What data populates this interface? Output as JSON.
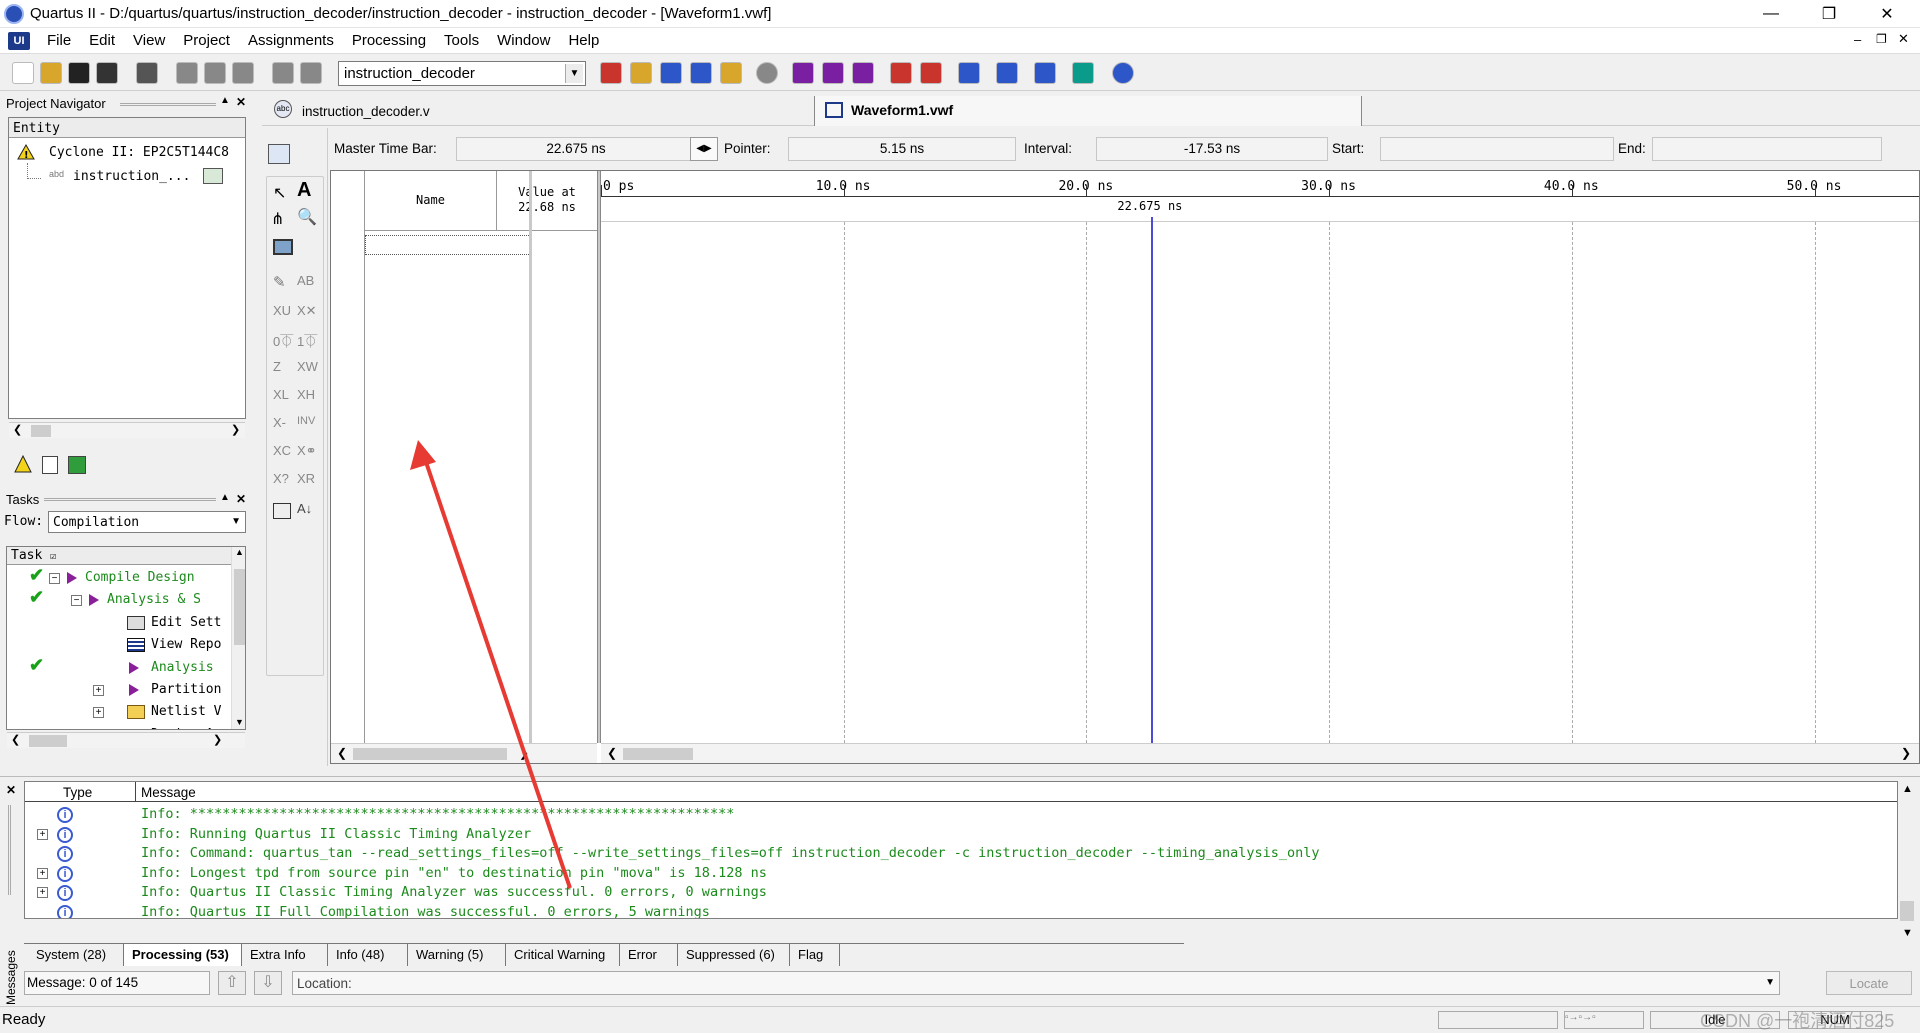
{
  "window": {
    "title": "Quartus II - D:/quartus/quartus/instruction_decoder/instruction_decoder - instruction_decoder - [Waveform1.vwf]"
  },
  "menu": [
    "File",
    "Edit",
    "View",
    "Project",
    "Assignments",
    "Processing",
    "Tools",
    "Window",
    "Help"
  ],
  "toolbar": {
    "entity_value": "instruction_decoder"
  },
  "project_navigator": {
    "title": "Project Navigator",
    "column": "Entity",
    "device": "Cyclone II: EP2C5T144C8",
    "entity": "instruction_..."
  },
  "tasks": {
    "title": "Tasks",
    "flow_label": "Flow:",
    "flow_value": "Compilation",
    "column": "Task",
    "items": [
      {
        "label": "Compile Design",
        "done": true,
        "indent": 0
      },
      {
        "label": "Analysis & S",
        "done": true,
        "indent": 1
      },
      {
        "label": "Edit Sett",
        "done": false,
        "indent": 2
      },
      {
        "label": "View Repo",
        "done": false,
        "indent": 2
      },
      {
        "label": "Analysis",
        "done": true,
        "indent": 2
      },
      {
        "label": "Partition",
        "done": false,
        "indent": 2
      },
      {
        "label": "Netlist V",
        "done": false,
        "indent": 2
      },
      {
        "label": "Design As",
        "done": false,
        "indent": 2
      }
    ]
  },
  "doc_tabs": {
    "source": "instruction_decoder.v",
    "waveform": "Waveform1.vwf"
  },
  "timebar": {
    "master_label": "Master Time Bar:",
    "master_value": "22.675 ns",
    "pointer_label": "Pointer:",
    "pointer_value": "5.15 ns",
    "interval_label": "Interval:",
    "interval_value": "-17.53 ns",
    "start_label": "Start:",
    "start_value": "",
    "end_label": "End:",
    "end_value": ""
  },
  "waveform": {
    "name_header": "Name",
    "value_header_1": "Value at",
    "value_header_2": "22.68 ns",
    "ticks": [
      "0 ps",
      "10.0 ns",
      "20.0 ns",
      "30.0 ns",
      "40.0 ns",
      "50.0 ns"
    ],
    "cursor_label": "22.675 ns",
    "cursor_ns": 22.675,
    "range_ns": [
      0,
      54.3
    ]
  },
  "messages": {
    "header_type": "Type",
    "header_message": "Message",
    "lines": [
      {
        "text": "Info: *******************************************************************",
        "expand": false
      },
      {
        "text": "Info: Running Quartus II Classic Timing Analyzer",
        "expand": true
      },
      {
        "text": "Info: Command: quartus_tan --read_settings_files=off --write_settings_files=off instruction_decoder -c instruction_decoder --timing_analysis_only",
        "expand": false
      },
      {
        "text": "Info: Longest tpd from source pin \"en\" to destination pin \"mova\" is 18.128 ns",
        "expand": true
      },
      {
        "text": "Info: Quartus II Classic Timing Analyzer was successful. 0 errors, 0 warnings",
        "expand": true
      },
      {
        "text": "Info: Quartus II Full Compilation was successful. 0 errors, 5 warnings",
        "expand": false
      }
    ],
    "tabs": [
      "System (28)",
      "Processing (53)",
      "Extra Info",
      "Info (48)",
      "Warning (5)",
      "Critical Warning",
      "Error",
      "Suppressed (6)",
      "Flag"
    ],
    "active_tab": 1,
    "side_label": "Messages",
    "count_text": "Message: 0 of 145",
    "location_label": "Location:",
    "locate_button": "Locate"
  },
  "status": {
    "ready": "Ready",
    "idle": "Idle",
    "num": "NUM",
    "watermark": "CSDN @一袍清酒付825"
  },
  "colors": {
    "cursor": "#4b4bd6",
    "arrow": "#e63a32",
    "message_green": "#1c8a1c"
  }
}
